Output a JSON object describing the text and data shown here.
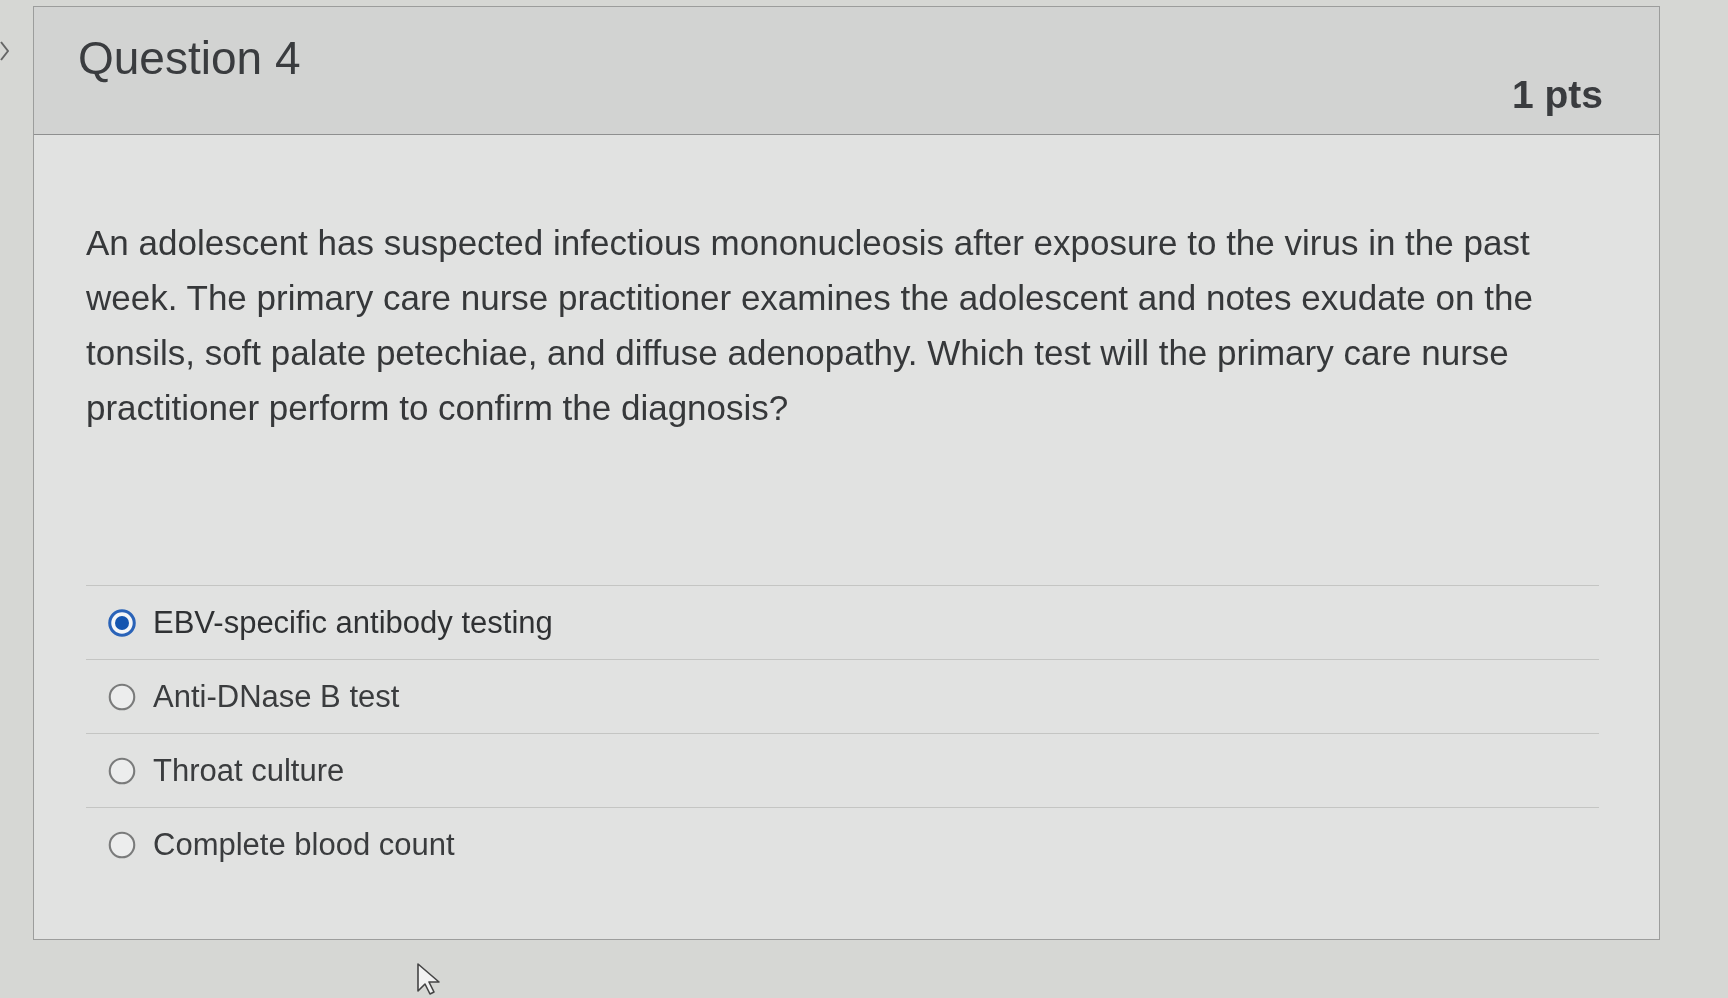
{
  "question": {
    "title": "Question 4",
    "points": "1 pts",
    "text": "An adolescent has suspected infectious mononucleosis after exposure to the virus in the past week. The primary care nurse practitioner examines the adolescent and notes exudate on the tonsils, soft palate petechiae, and diffuse adenopathy. Which test will the primary care nurse practitioner perform to confirm the diagnosis?",
    "answers": [
      {
        "label": "EBV-specific antibody testing",
        "selected": true
      },
      {
        "label": "Anti-DNase B test",
        "selected": false
      },
      {
        "label": "Throat culture",
        "selected": false
      },
      {
        "label": "Complete blood count",
        "selected": false
      }
    ]
  }
}
